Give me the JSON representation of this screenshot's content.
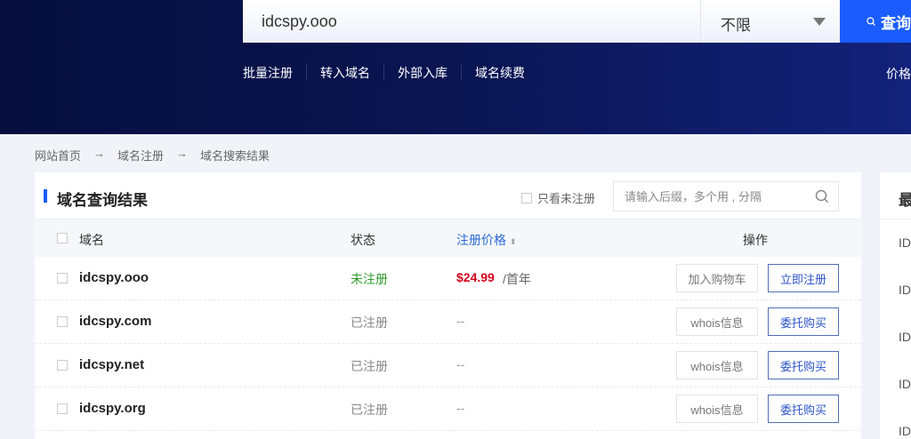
{
  "search": {
    "value": "idcspy.ooo",
    "select": "不限",
    "button": "查询"
  },
  "nav": [
    "批量注册",
    "转入域名",
    "外部入库",
    "域名续费"
  ],
  "nav_right": "价格",
  "breadcrumb": [
    "网站首页",
    "→",
    "域名注册",
    "→",
    "域名搜索结果"
  ],
  "results": {
    "title": "域名查询结果",
    "only_unregistered": "只看未注册",
    "filter_placeholder": "请输入后缀，多个用 , 分隔",
    "headers": {
      "domain": "域名",
      "status": "状态",
      "price": "注册价格",
      "ops": "操作"
    },
    "rows": [
      {
        "domain": "idcspy.ooo",
        "status": "未注册",
        "price": "$24.99",
        "unit": "/首年",
        "b1": "加入购物车",
        "b2": "立即注册"
      },
      {
        "domain": "idcspy.com",
        "status": "已注册",
        "price": "--",
        "unit": "",
        "b1": "whois信息",
        "b2": "委托购买"
      },
      {
        "domain": "idcspy.net",
        "status": "已注册",
        "price": "--",
        "unit": "",
        "b1": "whois信息",
        "b2": "委托购买"
      },
      {
        "domain": "idcspy.org",
        "status": "已注册",
        "price": "--",
        "unit": "",
        "b1": "whois信息",
        "b2": "委托购买"
      }
    ]
  },
  "side": {
    "title": "最",
    "items": [
      "ID",
      "ID",
      "ID",
      "ID",
      "ID"
    ]
  },
  "colors": {
    "accent": "#1a5cff",
    "available": "#2e9b2e",
    "price": "#d0021b"
  }
}
